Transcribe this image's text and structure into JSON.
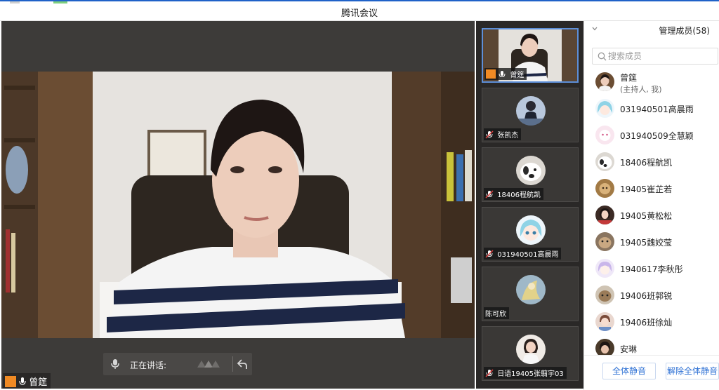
{
  "window": {
    "title": "腾讯会议"
  },
  "main_video": {
    "speaker_name": "曾筳",
    "speaking_label": "正在讲话:"
  },
  "video_strip": [
    {
      "name": "曾筳",
      "mic": "on",
      "active": true
    },
    {
      "name": "张凯杰",
      "mic": "muted"
    },
    {
      "name": "18406程航凯",
      "mic": "muted"
    },
    {
      "name": "031940501高晨雨",
      "mic": "muted"
    },
    {
      "name": "陈可欣",
      "mic": "none"
    },
    {
      "name": "日语19405张翦宇03",
      "mic": "muted"
    }
  ],
  "members_panel": {
    "title": "管理成员(58)",
    "search_placeholder": "搜索成员",
    "host": {
      "name": "曾筳",
      "sub": "(主持人, 我)"
    },
    "members": [
      "031940501高晨雨",
      "031940509全慧颖",
      "18406程航凯",
      "19405崔芷若",
      "19405黄松松",
      "19405魏姣莹",
      "1940617李秋彤",
      "19406班郭锐",
      "19406班徐灿",
      "安琳"
    ],
    "mute_all_label": "全体静音",
    "unmute_all_label": "解除全体静音"
  },
  "colors": {
    "accent": "#2b6fd4",
    "titlebar_top": "#1f62c8",
    "stage_bg": "#3d3b39",
    "strip_bg": "#2a2827",
    "camera_badge": "#f08a24"
  },
  "icons": [
    "camera-icon",
    "mic-icon",
    "mic-muted-icon",
    "search-icon",
    "chevron-down-icon",
    "back-arrow-icon"
  ]
}
